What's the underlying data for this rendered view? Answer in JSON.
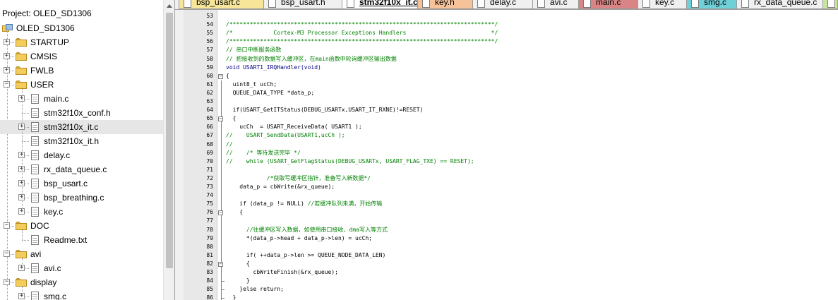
{
  "project": {
    "title": "Project: OLED_SD1306",
    "root": "OLED_SD1306",
    "tree": [
      {
        "label": "STARTUP",
        "type": "folder",
        "level": 1,
        "state": "+"
      },
      {
        "label": "CMSIS",
        "type": "folder",
        "level": 1,
        "state": "+"
      },
      {
        "label": "FWLB",
        "type": "folder",
        "level": 1,
        "state": "+"
      },
      {
        "label": "USER",
        "type": "folder",
        "level": 1,
        "state": "-"
      },
      {
        "label": "main.c",
        "type": "file",
        "level": 2,
        "state": "+"
      },
      {
        "label": "stm32f10x_conf.h",
        "type": "file",
        "level": 2,
        "state": ""
      },
      {
        "label": "stm32f10x_it.c",
        "type": "file",
        "level": 2,
        "state": "+",
        "selected": true
      },
      {
        "label": "stm32f10x_it.h",
        "type": "file",
        "level": 2,
        "state": ""
      },
      {
        "label": "delay.c",
        "type": "file",
        "level": 2,
        "state": "+"
      },
      {
        "label": "rx_data_queue.c",
        "type": "file",
        "level": 2,
        "state": "+"
      },
      {
        "label": "bsp_usart.c",
        "type": "file",
        "level": 2,
        "state": "+"
      },
      {
        "label": "bsp_breathing.c",
        "type": "file",
        "level": 2,
        "state": "+"
      },
      {
        "label": "key.c",
        "type": "file",
        "level": 2,
        "state": "+"
      },
      {
        "label": "DOC",
        "type": "folder",
        "level": 1,
        "state": "-"
      },
      {
        "label": "Readme.txt",
        "type": "file",
        "level": 2,
        "state": ""
      },
      {
        "label": "avi",
        "type": "folder",
        "level": 1,
        "state": "-"
      },
      {
        "label": "avi.c",
        "type": "file",
        "level": 2,
        "state": "+"
      },
      {
        "label": "display",
        "type": "folder",
        "level": 1,
        "state": "-"
      },
      {
        "label": "smg.c",
        "type": "file",
        "level": 2,
        "state": "+"
      }
    ]
  },
  "tabs": [
    {
      "label": "bsp_usart.c",
      "color": "#f7e69a",
      "active": false
    },
    {
      "label": "bsp_usart.h",
      "color": "#f0f0f0",
      "active": false
    },
    {
      "label": "stm32f10x_it.c",
      "color": "#ffffff",
      "active": true
    },
    {
      "label": "key.h",
      "color": "#f5c29a",
      "active": false
    },
    {
      "label": "delay.c",
      "color": "#f0f0f0",
      "active": false
    },
    {
      "label": "avi.c",
      "color": "#f0f0f0",
      "active": false
    },
    {
      "label": "main.c",
      "color": "#d98585",
      "active": false
    },
    {
      "label": "key.c",
      "color": "#f0f0f0",
      "active": false
    },
    {
      "label": "smg.c",
      "color": "#6fd0d8",
      "active": false
    },
    {
      "label": "rx_data_queue.c",
      "color": "#f0f0f0",
      "active": false
    },
    {
      "label": "",
      "color": "#c8e6a0",
      "active": false
    }
  ],
  "editor": {
    "lines": [
      {
        "n": "53",
        "text": "",
        "kind": "plain"
      },
      {
        "n": "54",
        "text": "/******************************************************************************/",
        "kind": "comment"
      },
      {
        "n": "55",
        "text": "/*            Cortex-M3 Processor Exceptions Handlers                         */",
        "kind": "comment"
      },
      {
        "n": "56",
        "text": "/******************************************************************************/",
        "kind": "comment"
      },
      {
        "n": "57",
        "text": "// 串口中断服务函数",
        "kind": "comment"
      },
      {
        "n": "58",
        "text": "// 把接收到的数据写入缓冲区，在main函数中轮询缓冲区输出数据",
        "kind": "comment"
      },
      {
        "n": "59",
        "text": "void USART1_IRQHandler(void)",
        "kind": "keyword"
      },
      {
        "n": "60",
        "text": "{",
        "kind": "plain"
      },
      {
        "n": "61",
        "text": "  uint8_t ucCh;",
        "kind": "plain"
      },
      {
        "n": "62",
        "text": "  QUEUE_DATA_TYPE *data_p;",
        "kind": "plain"
      },
      {
        "n": "63",
        "text": "",
        "kind": "plain"
      },
      {
        "n": "64",
        "text": "  if(USART_GetITStatus(DEBUG_USARTx,USART_IT_RXNE)!=RESET)",
        "kind": "plain"
      },
      {
        "n": "65",
        "text": "  {",
        "kind": "plain"
      },
      {
        "n": "66",
        "text": "    ucCh  = USART_ReceiveData( USART1 );",
        "kind": "plain"
      },
      {
        "n": "67",
        "text": "//    USART_SendData(USART1,ucCh );",
        "kind": "comment"
      },
      {
        "n": "68",
        "text": "//",
        "kind": "comment"
      },
      {
        "n": "69",
        "text": "//    /* 等待发送完毕 */",
        "kind": "comment"
      },
      {
        "n": "70",
        "text": "//    while (USART_GetFlagStatus(DEBUG_USARTx, USART_FLAG_TXE) == RESET);",
        "kind": "comment"
      },
      {
        "n": "71",
        "text": "",
        "kind": "plain"
      },
      {
        "n": "72",
        "text": "            /*获取写缓冲区指针，准备写入新数据*/",
        "kind": "comment"
      },
      {
        "n": "73",
        "text": "    data_p = cbWrite(&rx_queue);",
        "kind": "plain"
      },
      {
        "n": "74",
        "text": "",
        "kind": "plain"
      },
      {
        "n": "75",
        "code": "    if (data_p != NULL) ",
        "comment": "//若缓冲队列未满，开始传输",
        "kind": "mixed"
      },
      {
        "n": "76",
        "text": "    {",
        "kind": "plain"
      },
      {
        "n": "77",
        "text": "",
        "kind": "plain"
      },
      {
        "n": "78",
        "text": "      //往缓冲区写入数据，如使用串口接收、dma写入等方式",
        "kind": "comment"
      },
      {
        "n": "79",
        "text": "      *(data_p->head + data_p->len) = ucCh;",
        "kind": "plain"
      },
      {
        "n": "80",
        "text": "",
        "kind": "plain"
      },
      {
        "n": "81",
        "text": "      if( ++data_p->len >= QUEUE_NODE_DATA_LEN)",
        "kind": "plain"
      },
      {
        "n": "82",
        "text": "      {",
        "kind": "plain"
      },
      {
        "n": "83",
        "text": "        cbWriteFinish(&rx_queue);",
        "kind": "plain"
      },
      {
        "n": "84",
        "text": "      }",
        "kind": "plain"
      },
      {
        "n": "85",
        "text": "    }else return;",
        "kind": "plain"
      },
      {
        "n": "86",
        "text": "  }",
        "kind": "plain"
      }
    ]
  }
}
